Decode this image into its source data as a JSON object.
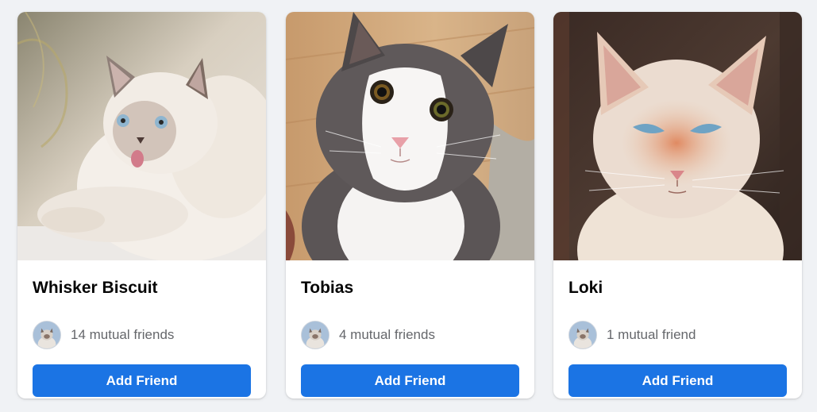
{
  "accent_color": "#1b74e4",
  "suggestions": [
    {
      "name": "Whisker Biscuit",
      "mutual_friends": "14 mutual friends",
      "action_label": "Add Friend",
      "photo": "fluffy-himalayan-cat-photo"
    },
    {
      "name": "Tobias",
      "mutual_friends": "4 mutual friends",
      "action_label": "Add Friend",
      "photo": "gray-white-tuxedo-cat-photo"
    },
    {
      "name": "Loki",
      "mutual_friends": "1 mutual friend",
      "action_label": "Add Friend",
      "photo": "cream-orange-cat-photo"
    }
  ]
}
